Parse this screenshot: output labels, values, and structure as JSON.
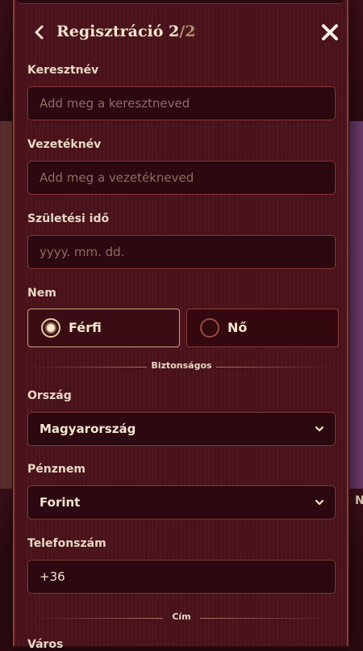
{
  "header": {
    "title": "Regisztráció 2",
    "step": "/2"
  },
  "fields": {
    "first_name": {
      "label": "Keresztnév",
      "placeholder": "Add meg a keresztneved"
    },
    "last_name": {
      "label": "Vezetéknév",
      "placeholder": "Add meg a vezetékneved"
    },
    "birth_date": {
      "label": "Születési idő",
      "placeholder": "yyyy. mm. dd."
    },
    "gender": {
      "label": "Nem",
      "options": [
        "Férfi",
        "Nő"
      ],
      "selected": "Férfi"
    },
    "country": {
      "label": "Ország",
      "value": "Magyarország"
    },
    "currency": {
      "label": "Pénznem",
      "value": "Forint"
    },
    "phone": {
      "label": "Telefonszám",
      "value": "+36"
    },
    "city": {
      "label": "Város"
    }
  },
  "dividers": {
    "secure": "Biztonságos",
    "address": "Cím"
  },
  "background": {
    "tab_fragment": "N"
  },
  "colors": {
    "panel": "#4a1119",
    "accent": "#c9a77a",
    "border": "#8a3a36"
  }
}
